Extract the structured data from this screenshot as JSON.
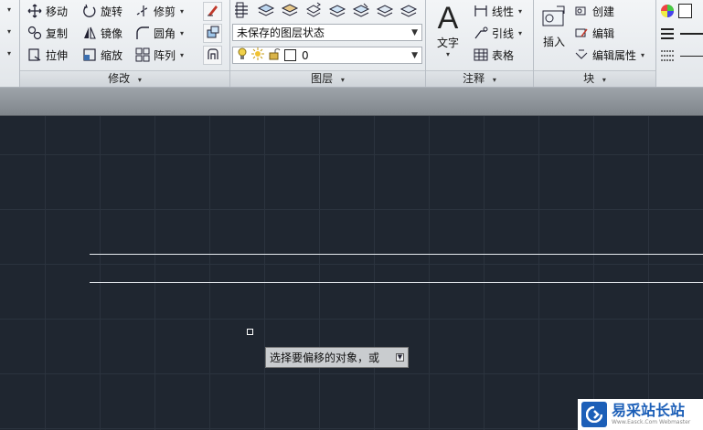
{
  "ribbon": {
    "modify": {
      "title": "修改",
      "move": "移动",
      "rotate": "旋转",
      "trim": "修剪",
      "copy": "复制",
      "mirror": "镜像",
      "fillet": "圆角",
      "stretch": "拉伸",
      "scale": "缩放",
      "array": "阵列"
    },
    "layers": {
      "title": "图层",
      "layer_state": "未保存的图层状态",
      "current_layer": "0"
    },
    "annotation": {
      "title": "注释",
      "text": "文字",
      "dimension": "线性",
      "leader": "引线",
      "table": "表格"
    },
    "block": {
      "title": "块",
      "insert": "插入",
      "create": "创建",
      "edit": "编辑",
      "edit_attributes": "编辑属性"
    }
  },
  "command": {
    "prompt": "选择要偏移的对象，或"
  },
  "watermark": {
    "name": "易采站长站",
    "url": "Www.Easck.Com Webmaster"
  },
  "colors": {
    "canvas": "#1f2630",
    "grid": "#2b333e",
    "ribbon": "#e6e9ec",
    "line": "#e8ecf0",
    "brand": "#1c5fb8"
  }
}
